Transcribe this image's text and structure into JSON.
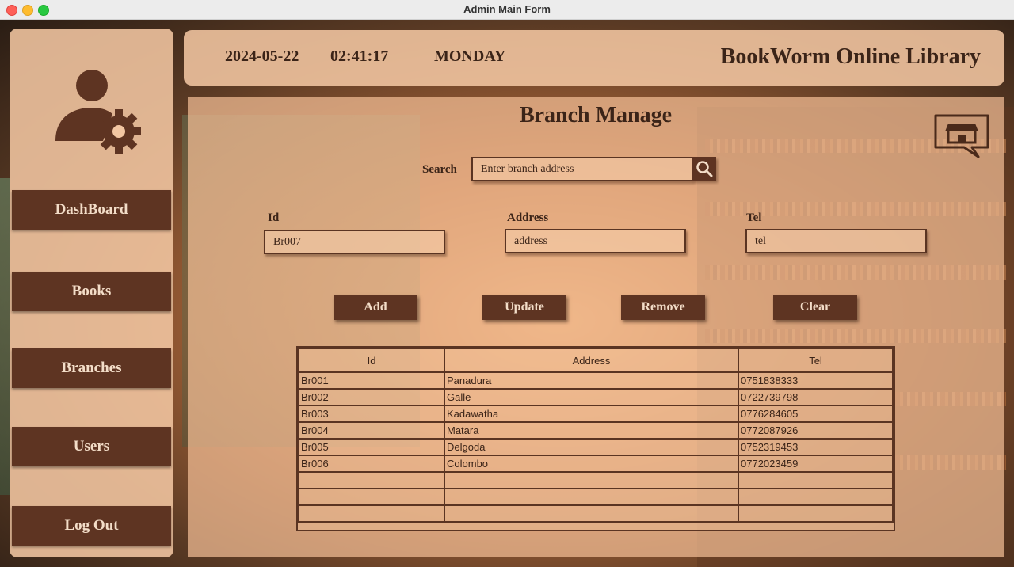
{
  "window": {
    "title": "Admin Main Form"
  },
  "sidebar": {
    "items": [
      {
        "label": "DashBoard"
      },
      {
        "label": "Books"
      },
      {
        "label": "Branches"
      },
      {
        "label": "Users"
      },
      {
        "label": "Log Out"
      }
    ]
  },
  "header": {
    "date": "2024-05-22",
    "time": "02:41:17",
    "day": "MONDAY",
    "brand": "BookWorm Online Library"
  },
  "main": {
    "title": "Branch Manage",
    "search": {
      "label": "Search",
      "placeholder": "Enter branch address"
    },
    "form": {
      "id_label": "Id",
      "id_value": "Br007",
      "address_label": "Address",
      "address_value": "address",
      "tel_label": "Tel",
      "tel_value": "tel"
    },
    "buttons": {
      "add": "Add",
      "update": "Update",
      "remove": "Remove",
      "clear": "Clear"
    },
    "table": {
      "columns": [
        "Id",
        "Address",
        "Tel"
      ],
      "rows": [
        [
          "Br001",
          "Panadura",
          "0751838333"
        ],
        [
          "Br002",
          "Galle",
          "0722739798"
        ],
        [
          "Br003",
          "Kadawatha",
          "0776284605"
        ],
        [
          "Br004",
          "Matara",
          "0772087926"
        ],
        [
          "Br005",
          "Delgoda",
          "0752319453"
        ],
        [
          "Br006",
          "Colombo",
          "0772023459"
        ]
      ]
    }
  },
  "colors": {
    "accent": "#5e3422",
    "panel": "#f2c6a2",
    "text": "#3b2418"
  },
  "icons": [
    "user-gear-icon",
    "search-icon",
    "store-icon"
  ]
}
